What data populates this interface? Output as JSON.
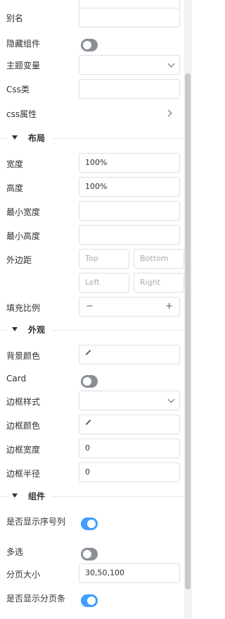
{
  "basic": {
    "alias_label": "别名",
    "hide_label": "隐藏组件",
    "hide_value": false,
    "theme_label": "主题变量",
    "css_class_label": "Css类",
    "css_attr_label": "css属性"
  },
  "layout": {
    "title": "布局",
    "width_label": "宽度",
    "width_value": "100%",
    "height_label": "高度",
    "height_value": "100%",
    "min_width_label": "最小宽度",
    "min_height_label": "最小高度",
    "margin_label": "外边距",
    "margin_top": "Top",
    "margin_bottom": "Bottom",
    "margin_left": "Left",
    "margin_right": "Right",
    "flex_label": "填充比例",
    "flex_minus": "−",
    "flex_plus": "+"
  },
  "appearance": {
    "title": "外观",
    "bg_color_label": "背景颜色",
    "card_label": "Card",
    "card_value": false,
    "border_style_label": "边框样式",
    "border_color_label": "边框颜色",
    "border_width_label": "边框宽度",
    "border_width_value": "0",
    "border_radius_label": "边框半径",
    "border_radius_value": "0"
  },
  "component": {
    "title": "组件",
    "show_index_label": "是否显示序号列",
    "show_index_value": true,
    "multi_label": "多选",
    "multi_value": false,
    "page_size_label": "分页大小",
    "page_size_value": "30,50,100",
    "show_pager_label": "是否显示分页条",
    "show_pager_value": true
  },
  "colors": {
    "toggle_on": "#409eff",
    "toggle_off": "#8a8e95"
  }
}
